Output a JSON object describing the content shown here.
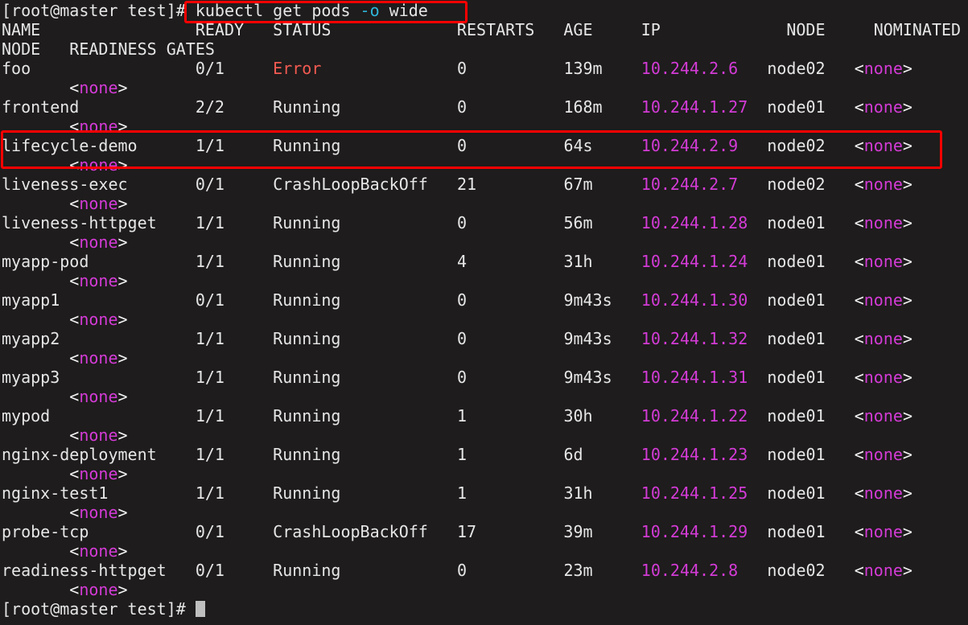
{
  "terminal": {
    "background_color": "#1e1c1c",
    "foreground_color": "#e6e6e6",
    "prompt": "[root@master test]#",
    "command": "kubectl get pods",
    "command_flag": "-o",
    "command_flag_value": "wide",
    "trailing_prompt": "[root@master test]#",
    "cursor": "block-cursor"
  },
  "colors": {
    "annotation_red": "#fe0000",
    "ip_magenta": "#d33bd6",
    "error_red": "#f25a52",
    "flag_cyan": "#2fb5d9",
    "text_white": "#f2f2f2"
  },
  "table": {
    "headers": [
      "NAME",
      "READY",
      "STATUS",
      "RESTARTS",
      "AGE",
      "IP",
      "NODE",
      "NOMINATED NODE",
      "READINESS GATES"
    ],
    "header_line_1": "NAME                READY   STATUS             RESTARTS   AGE     IP             NODE     NOMINATED",
    "header_line_2": "NODE   READINESS GATES",
    "wrap_indent": "       ",
    "rows": [
      {
        "name": "foo",
        "ready": "0/1",
        "status": "Error",
        "status_color": "error",
        "restarts": "0",
        "age": "139m",
        "ip": "10.244.2.6",
        "node": "node02",
        "nominated_node": "<none>",
        "readiness_gates": "<none>"
      },
      {
        "name": "frontend",
        "ready": "2/2",
        "status": "Running",
        "status_color": "default",
        "restarts": "0",
        "age": "168m",
        "ip": "10.244.1.27",
        "node": "node01",
        "nominated_node": "<none>",
        "readiness_gates": "<none>"
      },
      {
        "name": "lifecycle-demo",
        "ready": "1/1",
        "status": "Running",
        "status_color": "default",
        "restarts": "0",
        "age": "64s",
        "ip": "10.244.2.9",
        "node": "node02",
        "nominated_node": "<none>",
        "readiness_gates": "<none>",
        "highlighted": true
      },
      {
        "name": "liveness-exec",
        "ready": "0/1",
        "status": "CrashLoopBackOff",
        "status_color": "default",
        "restarts": "21",
        "age": "67m",
        "ip": "10.244.2.7",
        "node": "node02",
        "nominated_node": "<none>",
        "readiness_gates": "<none>"
      },
      {
        "name": "liveness-httpget",
        "ready": "1/1",
        "status": "Running",
        "status_color": "default",
        "restarts": "0",
        "age": "56m",
        "ip": "10.244.1.28",
        "node": "node01",
        "nominated_node": "<none>",
        "readiness_gates": "<none>"
      },
      {
        "name": "myapp-pod",
        "ready": "1/1",
        "status": "Running",
        "status_color": "default",
        "restarts": "4",
        "age": "31h",
        "ip": "10.244.1.24",
        "node": "node01",
        "nominated_node": "<none>",
        "readiness_gates": "<none>"
      },
      {
        "name": "myapp1",
        "ready": "0/1",
        "status": "Running",
        "status_color": "default",
        "restarts": "0",
        "age": "9m43s",
        "ip": "10.244.1.30",
        "node": "node01",
        "nominated_node": "<none>",
        "readiness_gates": "<none>"
      },
      {
        "name": "myapp2",
        "ready": "1/1",
        "status": "Running",
        "status_color": "default",
        "restarts": "0",
        "age": "9m43s",
        "ip": "10.244.1.32",
        "node": "node01",
        "nominated_node": "<none>",
        "readiness_gates": "<none>"
      },
      {
        "name": "myapp3",
        "ready": "1/1",
        "status": "Running",
        "status_color": "default",
        "restarts": "0",
        "age": "9m43s",
        "ip": "10.244.1.31",
        "node": "node01",
        "nominated_node": "<none>",
        "readiness_gates": "<none>"
      },
      {
        "name": "mypod",
        "ready": "1/1",
        "status": "Running",
        "status_color": "default",
        "restarts": "1",
        "age": "30h",
        "ip": "10.244.1.22",
        "node": "node01",
        "nominated_node": "<none>",
        "readiness_gates": "<none>"
      },
      {
        "name": "nginx-deployment",
        "ready": "1/1",
        "status": "Running",
        "status_color": "default",
        "restarts": "1",
        "age": "6d",
        "ip": "10.244.1.23",
        "node": "node01",
        "nominated_node": "<none>",
        "readiness_gates": "<none>"
      },
      {
        "name": "nginx-test1",
        "ready": "1/1",
        "status": "Running",
        "status_color": "default",
        "restarts": "1",
        "age": "31h",
        "ip": "10.244.1.25",
        "node": "node01",
        "nominated_node": "<none>",
        "readiness_gates": "<none>"
      },
      {
        "name": "probe-tcp",
        "ready": "0/1",
        "status": "CrashLoopBackOff",
        "status_color": "default",
        "restarts": "17",
        "age": "39m",
        "ip": "10.244.1.29",
        "node": "node01",
        "nominated_node": "<none>",
        "readiness_gates": "<none>"
      },
      {
        "name": "readiness-httpget",
        "ready": "0/1",
        "status": "Running",
        "status_color": "default",
        "restarts": "0",
        "age": "23m",
        "ip": "10.244.2.8",
        "node": "node02",
        "nominated_node": "<none>",
        "readiness_gates": "<none>"
      }
    ]
  },
  "annotations": [
    {
      "name": "command-highlight",
      "target": "kubectl get pods -o wide"
    },
    {
      "name": "row-highlight",
      "target": "lifecycle-demo"
    }
  ]
}
